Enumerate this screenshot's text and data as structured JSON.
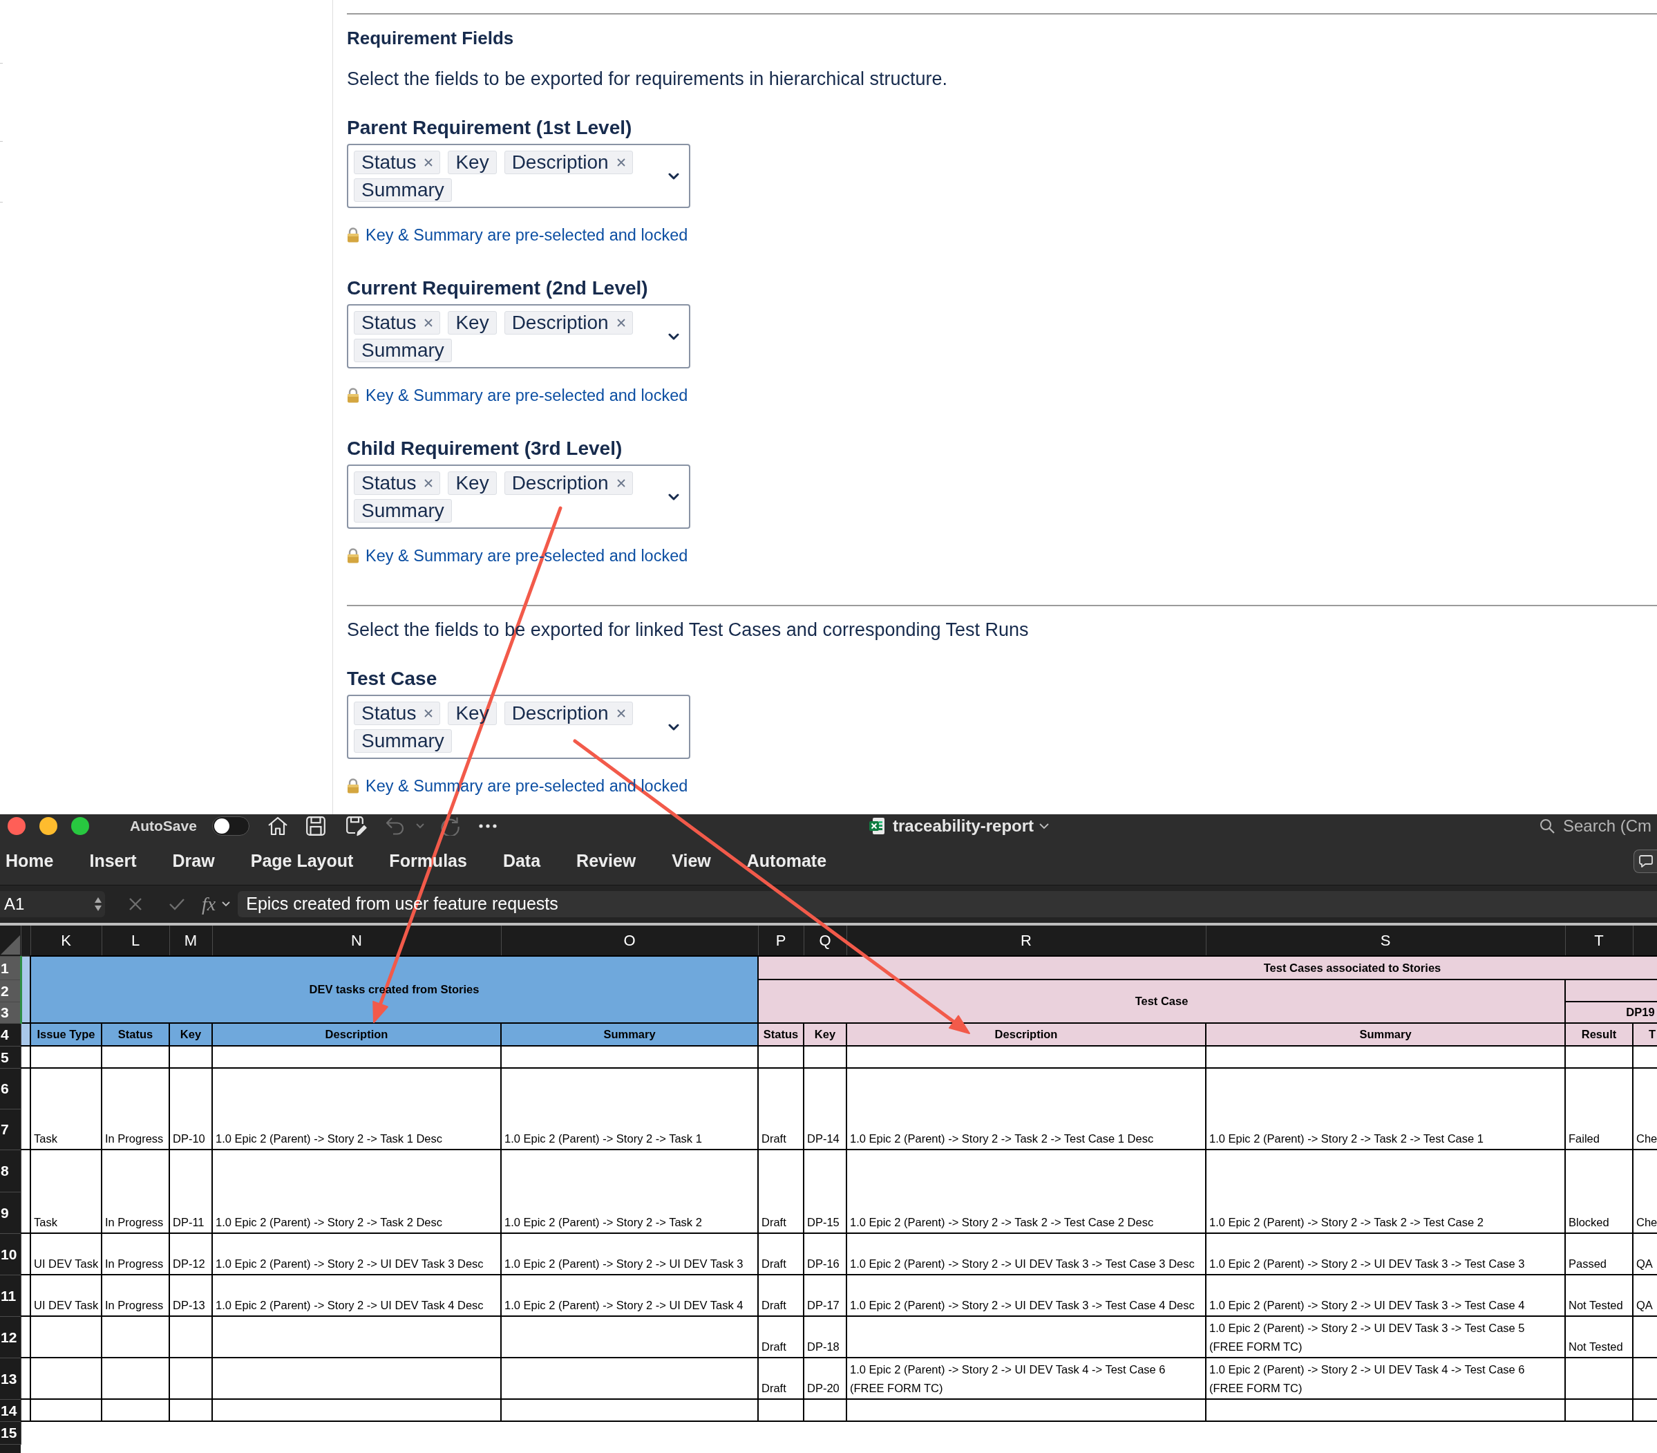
{
  "form": {
    "title": "Requirement Fields",
    "intro": "Select the fields to be exported for requirements in hierarchical structure.",
    "requirement_levels": [
      {
        "label": "Parent Requirement (1st Level)",
        "tags": [
          {
            "label": "Status",
            "locked": false
          },
          {
            "label": "Key",
            "locked": true
          },
          {
            "label": "Description",
            "locked": false
          },
          {
            "label": "Summary",
            "locked": true
          }
        ],
        "note": "Key & Summary are pre-selected and locked"
      },
      {
        "label": "Current Requirement (2nd Level)",
        "tags": [
          {
            "label": "Status",
            "locked": false
          },
          {
            "label": "Key",
            "locked": true
          },
          {
            "label": "Description",
            "locked": false
          },
          {
            "label": "Summary",
            "locked": true
          }
        ],
        "note": "Key & Summary are pre-selected and locked"
      },
      {
        "label": "Child Requirement (3rd Level)",
        "tags": [
          {
            "label": "Status",
            "locked": false
          },
          {
            "label": "Key",
            "locked": true
          },
          {
            "label": "Description",
            "locked": false
          },
          {
            "label": "Summary",
            "locked": true
          }
        ],
        "note": "Key & Summary are pre-selected and locked"
      }
    ],
    "test_intro": "Select the fields to be exported for linked Test Cases and corresponding Test Runs",
    "test_fields": [
      {
        "label": "Test Case",
        "tags": [
          {
            "label": "Status",
            "locked": false
          },
          {
            "label": "Key",
            "locked": true
          },
          {
            "label": "Description",
            "locked": false
          },
          {
            "label": "Summary",
            "locked": true
          }
        ],
        "note": "Key & Summary are pre-selected and locked"
      }
    ]
  },
  "excel": {
    "autosave": {
      "label": "AutoSave",
      "on": false
    },
    "quick_access": [
      {
        "kind": "home",
        "disabled": false
      },
      {
        "kind": "save",
        "disabled": false
      },
      {
        "kind": "save_as",
        "disabled": false
      },
      {
        "kind": "undo",
        "disabled": true
      },
      {
        "kind": "dropdown",
        "disabled": true
      },
      {
        "kind": "redo",
        "disabled": true
      },
      {
        "kind": "more",
        "disabled": false
      }
    ],
    "document_title": "traceability-report",
    "search": {
      "placeholder": "Search (Cm"
    },
    "ribbon_tabs": [
      {
        "label": "Home",
        "selected": false
      },
      {
        "label": "Insert",
        "selected": false
      },
      {
        "label": "Draw",
        "selected": false
      },
      {
        "label": "Page Layout",
        "selected": false
      },
      {
        "label": "Formulas",
        "selected": false
      },
      {
        "label": "Data",
        "selected": false
      },
      {
        "label": "Review",
        "selected": false
      },
      {
        "label": "View",
        "selected": false
      },
      {
        "label": "Automate",
        "selected": false
      }
    ],
    "name_box": "A1",
    "formula_actions": [
      {
        "kind": "cancel",
        "disabled": true
      },
      {
        "kind": "enter",
        "disabled": true
      }
    ],
    "function_button": "fx",
    "formula": "Epics created from user feature requests",
    "sheet": {
      "columns": [
        "K",
        "L",
        "M",
        "N",
        "O",
        "P",
        "Q",
        "R",
        "S",
        "T"
      ],
      "rows": [
        {
          "label": "1",
          "selected": true
        },
        {
          "label": "2",
          "selected": true
        },
        {
          "label": "3",
          "selected": true
        },
        {
          "label": "4",
          "selected": false
        },
        {
          "label": "5",
          "selected": false
        },
        {
          "label": "6",
          "selected": false
        },
        {
          "label": "7",
          "selected": false
        },
        {
          "label": "8",
          "selected": false
        },
        {
          "label": "9",
          "selected": false
        },
        {
          "label": "10",
          "selected": false
        },
        {
          "label": "11",
          "selected": false
        },
        {
          "label": "12",
          "selected": false
        },
        {
          "label": "13",
          "selected": false
        },
        {
          "label": "14",
          "selected": false
        },
        {
          "label": "15",
          "selected": false
        }
      ],
      "dev_banner": "DEV tasks created from Stories",
      "test_banner": "Test Cases associated to Stories",
      "test_case_group": "Test Case",
      "test_run_group": "DP19",
      "dev_columns": [
        "Issue Type",
        "Status",
        "Key",
        "Description",
        "Summary"
      ],
      "test_columns": [
        "Status",
        "Key",
        "Description",
        "Summary",
        "Result",
        "T"
      ],
      "records": [
        {
          "merged": true,
          "dev_task": {
            "issue_type": "Task",
            "status": "In Progress",
            "key": "DP-10",
            "description": "1.0 Epic 2 (Parent) -> Story 2 -> Task 1 Desc",
            "summary": "1.0 Epic 2 (Parent) -> Story 2 -> Task 1"
          },
          "test_case": {
            "status": "Draft",
            "key": "DP-14",
            "description": "1.0 Epic 2 (Parent) -> Story 2 -> Task 2 -> Test Case 1 Desc",
            "summary": "1.0 Epic 2 (Parent) -> Story 2 -> Task 2 -> Test Case 1",
            "result": "Failed",
            "column_u": "Che"
          }
        },
        {
          "merged": true,
          "dev_task": {
            "issue_type": "Task",
            "status": "In Progress",
            "key": "DP-11",
            "description": "1.0 Epic 2 (Parent) -> Story 2 -> Task 2 Desc",
            "summary": "1.0 Epic 2 (Parent) -> Story 2 -> Task 2"
          },
          "test_case": {
            "status": "Draft",
            "key": "DP-15",
            "description": "1.0 Epic 2 (Parent) -> Story 2 -> Task 2 -> Test Case 2 Desc",
            "summary": "1.0 Epic 2 (Parent) -> Story 2 -> Task 2 -> Test Case 2",
            "result": "Blocked",
            "column_u": "Che"
          }
        },
        {
          "merged": false,
          "dev_task": {
            "issue_type": "UI DEV Task",
            "status": "In Progress",
            "key": "DP-12",
            "description": "1.0 Epic 2 (Parent) -> Story 2 -> UI DEV Task 3 Desc",
            "summary": "1.0 Epic 2 (Parent) -> Story 2 -> UI DEV Task 3"
          },
          "test_case": {
            "status": "Draft",
            "key": "DP-16",
            "description": "1.0 Epic 2 (Parent) -> Story 2 -> UI DEV Task 3 -> Test Case 3 Desc",
            "summary": "1.0 Epic 2 (Parent) -> Story 2 -> UI DEV Task 3 -> Test Case 3",
            "result": "Passed",
            "column_u": "QA"
          }
        },
        {
          "merged": false,
          "dev_task": {
            "issue_type": "UI DEV Task",
            "status": "In Progress",
            "key": "DP-13",
            "description": "1.0 Epic 2 (Parent) -> Story 2 -> UI DEV Task 4 Desc",
            "summary": "1.0 Epic 2 (Parent) -> Story 2 -> UI DEV Task 4"
          },
          "test_case": {
            "status": "Draft",
            "key": "DP-17",
            "description": "1.0 Epic 2 (Parent) -> Story 2 -> UI DEV Task 3 -> Test Case 4 Desc",
            "summary": "1.0 Epic 2 (Parent) -> Story 2 -> UI DEV Task 3 -> Test Case 4",
            "result": "Not Tested",
            "column_u": "QA"
          }
        },
        {
          "merged": false,
          "test_case": {
            "status": "Draft",
            "key": "DP-18",
            "summary": "1.0 Epic 2 (Parent) -> Story 2 -> UI DEV Task 3 -> Test Case 5\n(FREE FORM TC)",
            "result": "Not Tested"
          }
        },
        {
          "merged": false,
          "test_case": {
            "status": "Draft",
            "key": "DP-20",
            "description": "1.0 Epic 2 (Parent) -> Story 2 -> UI DEV Task 4 -> Test Case 6\n(FREE FORM TC)",
            "summary": "1.0 Epic 2 (Parent) -> Story 2 -> UI DEV Task 4 -> Test Case 6\n(FREE FORM TC)"
          }
        }
      ]
    }
  }
}
